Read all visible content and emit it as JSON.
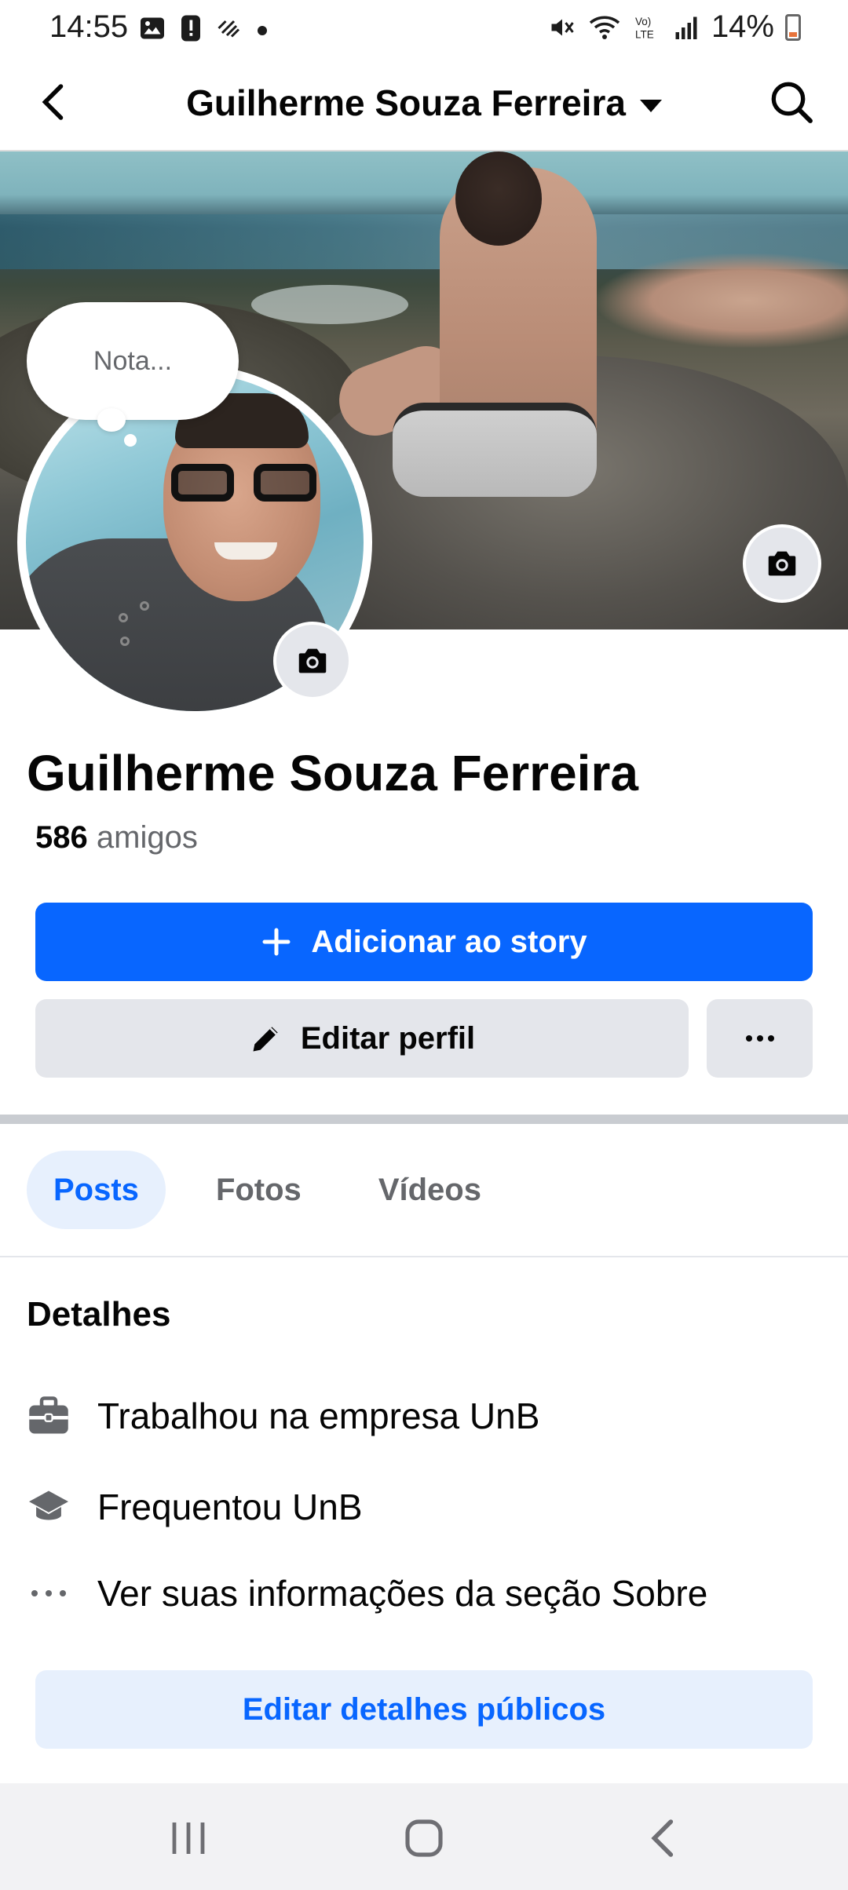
{
  "status_bar": {
    "time": "14:55",
    "battery": "14%",
    "icons_left": [
      "image-icon",
      "alert-icon",
      "pattern-icon",
      "dot-icon"
    ],
    "icons_right": [
      "mute-icon",
      "wifi-icon",
      "volte-icon",
      "signal-icon",
      "battery-icon"
    ]
  },
  "header": {
    "title": "Guilherme Souza Ferreira"
  },
  "profile": {
    "note_placeholder": "Nota...",
    "name": "Guilherme Souza Ferreira",
    "friends_count": "586",
    "friends_label": "amigos"
  },
  "actions": {
    "add_story": "Adicionar ao story",
    "edit_profile": "Editar perfil"
  },
  "tabs": [
    {
      "label": "Posts",
      "active": true
    },
    {
      "label": "Fotos",
      "active": false
    },
    {
      "label": "Vídeos",
      "active": false
    }
  ],
  "details": {
    "title": "Detalhes",
    "items": [
      {
        "icon": "briefcase-icon",
        "text": "Trabalhou na empresa UnB"
      },
      {
        "icon": "graduation-cap-icon",
        "text": "Frequentou UnB"
      },
      {
        "icon": "more-dots-icon",
        "text": "Ver suas informações da seção Sobre"
      }
    ],
    "edit_public_button": "Editar detalhes públicos"
  },
  "colors": {
    "accent": "#0866ff",
    "accent_light": "#e7f0fd",
    "button_gray": "#e4e6eb",
    "secondary_text": "#65676b"
  }
}
